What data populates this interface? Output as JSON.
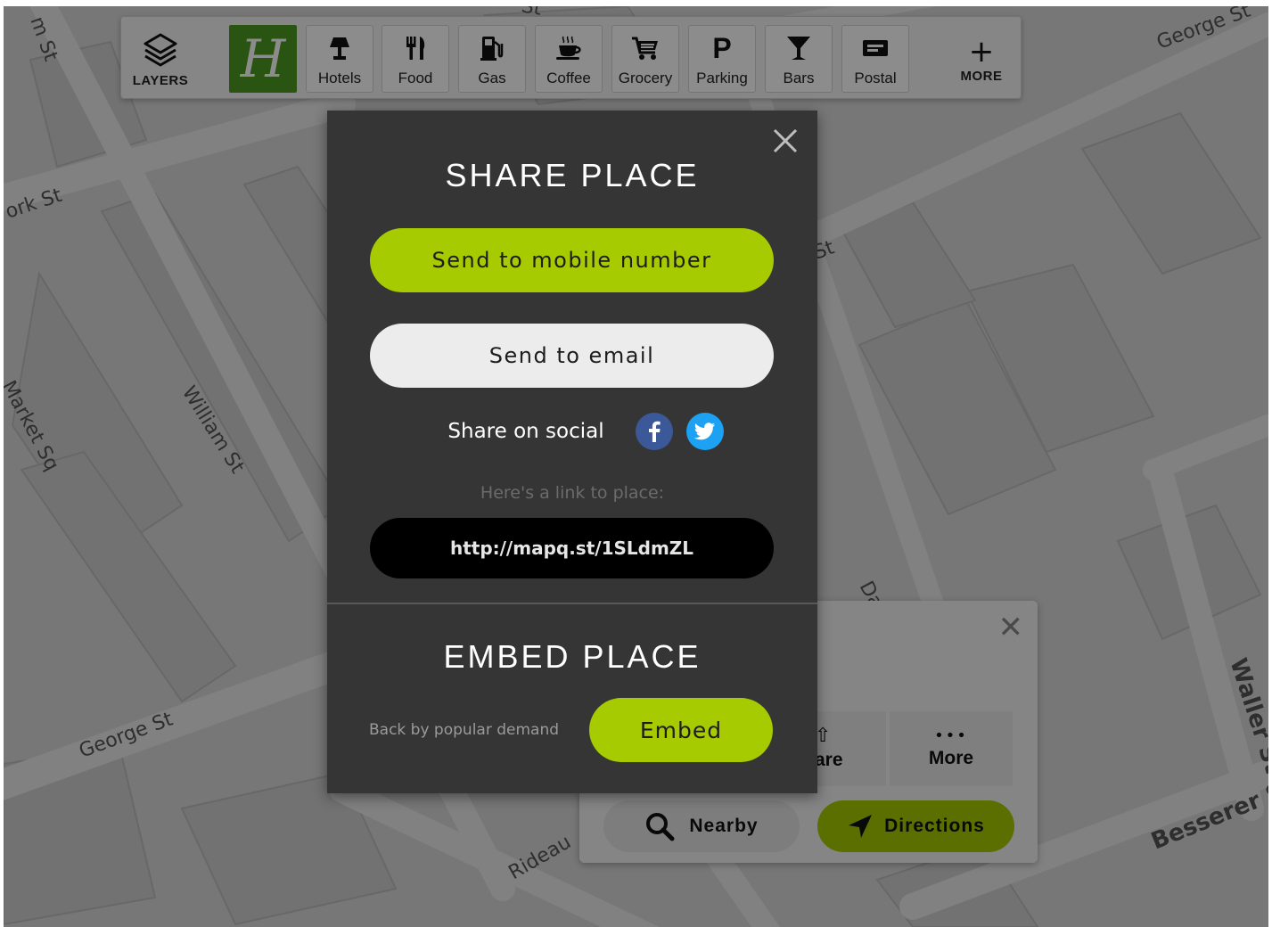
{
  "map": {
    "streets": [
      "m St",
      "ork St",
      "William St",
      "Market Sq",
      "George St",
      "George St",
      "Rideau",
      "Da",
      "Waller St",
      "Besserer St",
      "St",
      "St"
    ]
  },
  "toolbar": {
    "layers_label": "LAYERS",
    "brand_letter": "H",
    "categories": [
      {
        "label": "Hotels",
        "icon": "hotel-lamp-icon"
      },
      {
        "label": "Food",
        "icon": "fork-knife-icon"
      },
      {
        "label": "Gas",
        "icon": "gas-pump-icon"
      },
      {
        "label": "Coffee",
        "icon": "coffee-cup-icon"
      },
      {
        "label": "Grocery",
        "icon": "shopping-cart-icon"
      },
      {
        "label": "Parking",
        "icon": "parking-icon"
      },
      {
        "label": "Bars",
        "icon": "cocktail-icon"
      },
      {
        "label": "Postal",
        "icon": "mailbox-icon"
      }
    ],
    "more_label": "MORE"
  },
  "place_card": {
    "share_label": "are",
    "more_label": "More",
    "more_dots": "•••",
    "nearby_label": "Nearby",
    "directions_label": "Directions"
  },
  "modal": {
    "share_title": "SHARE PLACE",
    "send_mobile": "Send to mobile number",
    "send_email": "Send to email",
    "share_social": "Share on social",
    "link_caption": "Here's a link to place:",
    "link_url": "http://mapq.st/1SLdmZL",
    "embed_title": "EMBED PLACE",
    "embed_note": "Back by popular demand",
    "embed_button": "Embed"
  },
  "colors": {
    "accent_green": "#a6cb00",
    "modal_bg": "#353535",
    "facebook": "#3b5998",
    "twitter": "#1da1f2",
    "brand_green": "#4b9a1f"
  }
}
